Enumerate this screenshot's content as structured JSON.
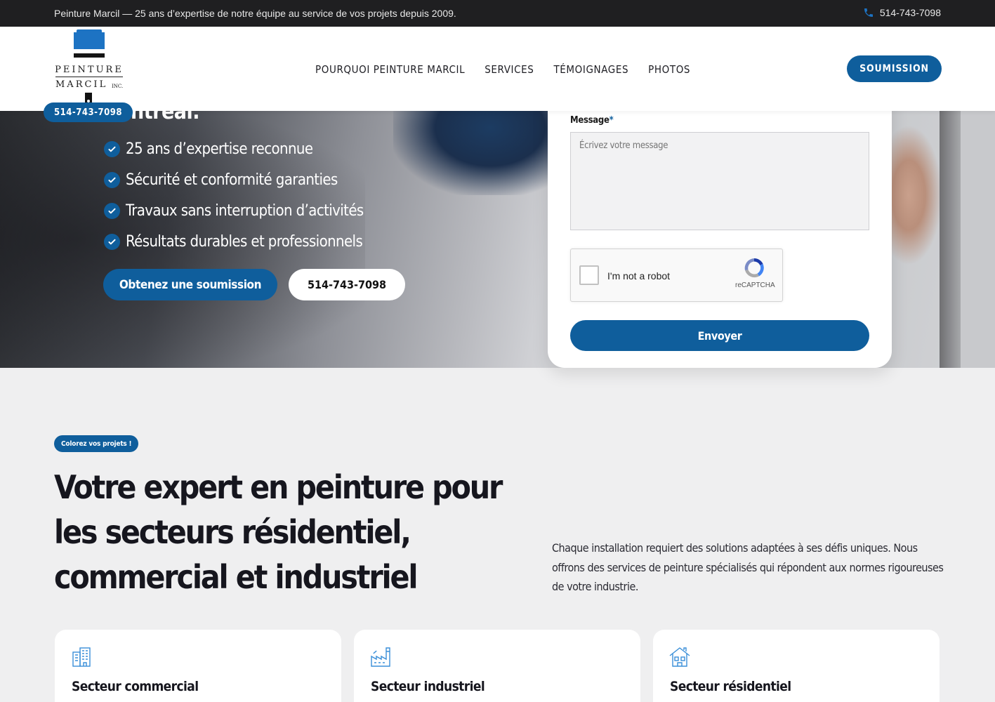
{
  "topbar": {
    "message": "Peinture Marcil — 25 ans d’expertise de notre équipe au service de vos projets depuis 2009.",
    "phone": "514-743-7098",
    "phone_icon": "phone-icon"
  },
  "header": {
    "logo_word1": "PEINTURE",
    "logo_word2": "MARCIL",
    "logo_inc": "INC.",
    "logo_phone": "514-743-7098",
    "nav": [
      "POURQUOI PEINTURE MARCIL",
      "SERVICES",
      "TÉMOIGNAGES",
      "PHOTOS"
    ],
    "cta": "SOUMISSION"
  },
  "hero": {
    "title_tail": "ntréal.",
    "checks": [
      "25 ans d’expertise reconnue",
      "Sécurité et conformité garanties",
      "Travaux sans interruption d’activités",
      "Résultats durables et professionnels"
    ],
    "btn_quote": "Obtenez une soumission",
    "btn_phone": "514-743-7098"
  },
  "form": {
    "message_label": "Message",
    "required_mark": "*",
    "message_placeholder": "Écrivez votre message",
    "recaptcha_text": "I'm not a robot",
    "recaptcha_brand": "reCAPTCHA",
    "submit": "Envoyer"
  },
  "section": {
    "tag": "Colorez vos projets !",
    "title": "Votre expert en peinture pour les secteurs résidentiel, commercial et industriel",
    "description": "Chaque installation requiert des solutions adaptées à ses défis uniques. Nous offrons des services de peinture spécialisés qui répondent aux normes rigoureuses de votre industrie."
  },
  "cards": [
    {
      "title": "Secteur commercial",
      "icon": "building-icon"
    },
    {
      "title": "Secteur industriel",
      "icon": "factory-icon"
    },
    {
      "title": "Secteur résidentiel",
      "icon": "house-icon"
    }
  ],
  "colors": {
    "brand_blue": "#0f5e9c",
    "logo_blue": "#1d73c3",
    "topbar_bg": "#1f1f21",
    "section_bg": "#efeff0"
  }
}
